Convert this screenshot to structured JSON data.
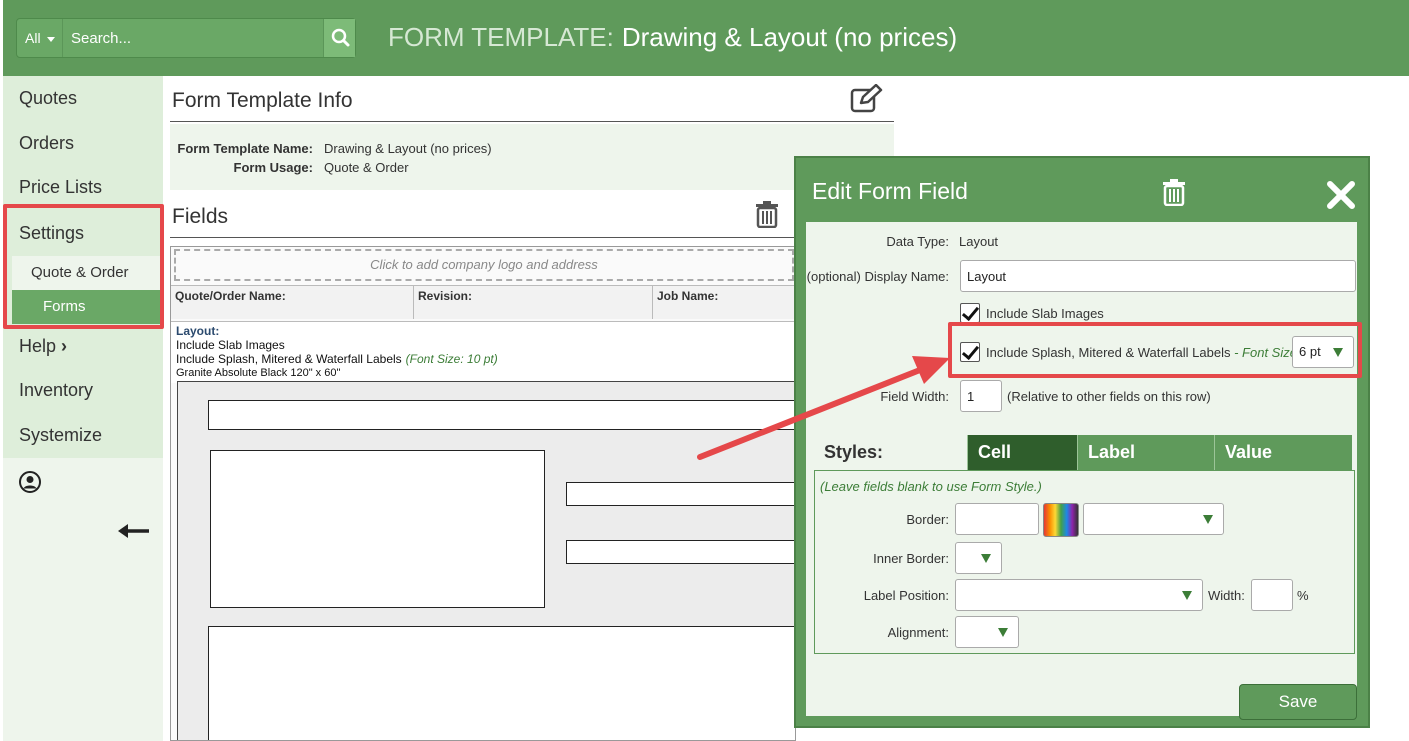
{
  "header": {
    "search_scope": "All",
    "search_placeholder": "Search...",
    "title_prefix": "FORM TEMPLATE:",
    "title": "Drawing & Layout (no prices)"
  },
  "sidebar": {
    "items": [
      "Quotes",
      "Orders",
      "Price Lists",
      "Settings",
      "Help",
      "Inventory",
      "Systemize"
    ],
    "settings_sub": [
      "Quote & Order",
      "Forms"
    ],
    "help_chevron": "›"
  },
  "info": {
    "section_title": "Form Template Info",
    "name_label": "Form Template Name:",
    "name_value": "Drawing & Layout (no prices)",
    "usage_label": "Form Usage:",
    "usage_value": "Quote & Order"
  },
  "fields": {
    "section_title": "Fields",
    "logo_placeholder": "Click to add company logo and address",
    "col1": "Quote/Order Name:",
    "col2": "Revision:",
    "col3": "Job Name:",
    "layout_label": "Layout:",
    "line1": "Include Slab Images",
    "line2": "Include Splash, Mitered & Waterfall Labels",
    "line2_note": "(Font Size: 10 pt)",
    "line3": "Granite Absolute Black 120\" x 60\""
  },
  "modal": {
    "title": "Edit Form Field",
    "data_type_label": "Data Type:",
    "data_type_value": "Layout",
    "display_name_label": "(optional) Display Name:",
    "display_name_value": "Layout",
    "check1_label": "Include Slab Images",
    "check2_label": "Include Splash, Mitered & Waterfall Labels",
    "font_size_label": "- Font Size:",
    "font_size_value": "6 pt",
    "field_width_label": "Field Width:",
    "field_width_value": "1",
    "field_width_note": "(Relative to other fields on this row)",
    "styles_title": "Styles:",
    "tabs": [
      "Cell",
      "Label",
      "Value"
    ],
    "styles_hint": "(Leave fields blank to use Form Style.)",
    "border_label": "Border:",
    "inner_border_label": "Inner Border:",
    "label_position_label": "Label Position:",
    "width_label": "Width:",
    "percent": "%",
    "alignment_label": "Alignment:",
    "save_label": "Save"
  },
  "colors": {
    "brand_green": "#5f9a5b",
    "dark_green": "#2f5e2c",
    "highlight_red": "#e5484a"
  }
}
